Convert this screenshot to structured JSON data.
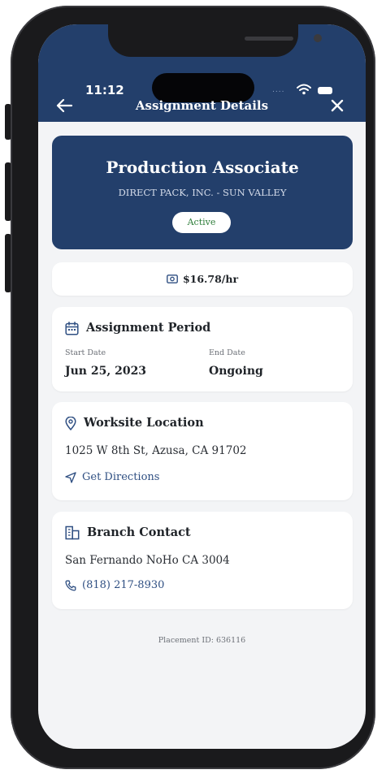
{
  "status_bar": {
    "time": "11:12",
    "signal": "....",
    "icons": [
      "wifi-icon",
      "battery-icon"
    ]
  },
  "header": {
    "title": "Assignment Details",
    "back_icon": "arrow-left-icon",
    "close_icon": "close-icon"
  },
  "assignment": {
    "job_title": "Production Associate",
    "company": "DIRECT PACK, INC. - SUN VALLEY",
    "status": "Active"
  },
  "pay": {
    "rate": "$16.78/hr",
    "icon": "money-icon"
  },
  "period": {
    "heading": "Assignment Period",
    "icon": "calendar-icon",
    "start_label": "Start Date",
    "start_value": "Jun 25, 2023",
    "end_label": "End Date",
    "end_value": "Ongoing"
  },
  "location": {
    "heading": "Worksite Location",
    "icon": "map-pin-icon",
    "address": "1025 W 8th St, Azusa, CA 91702",
    "directions_label": "Get Directions",
    "directions_icon": "navigation-arrow-icon"
  },
  "contact": {
    "heading": "Branch Contact",
    "icon": "building-icon",
    "branch": "San Fernando NoHo CA 3004",
    "phone": "(818) 217-8930",
    "phone_icon": "phone-icon"
  },
  "footer": {
    "placement_id": "Placement ID: 636116"
  },
  "colors": {
    "navy": "#233f6b",
    "background": "#f3f4f6",
    "link": "#2f4f82",
    "active_green": "#2e7d3a"
  }
}
